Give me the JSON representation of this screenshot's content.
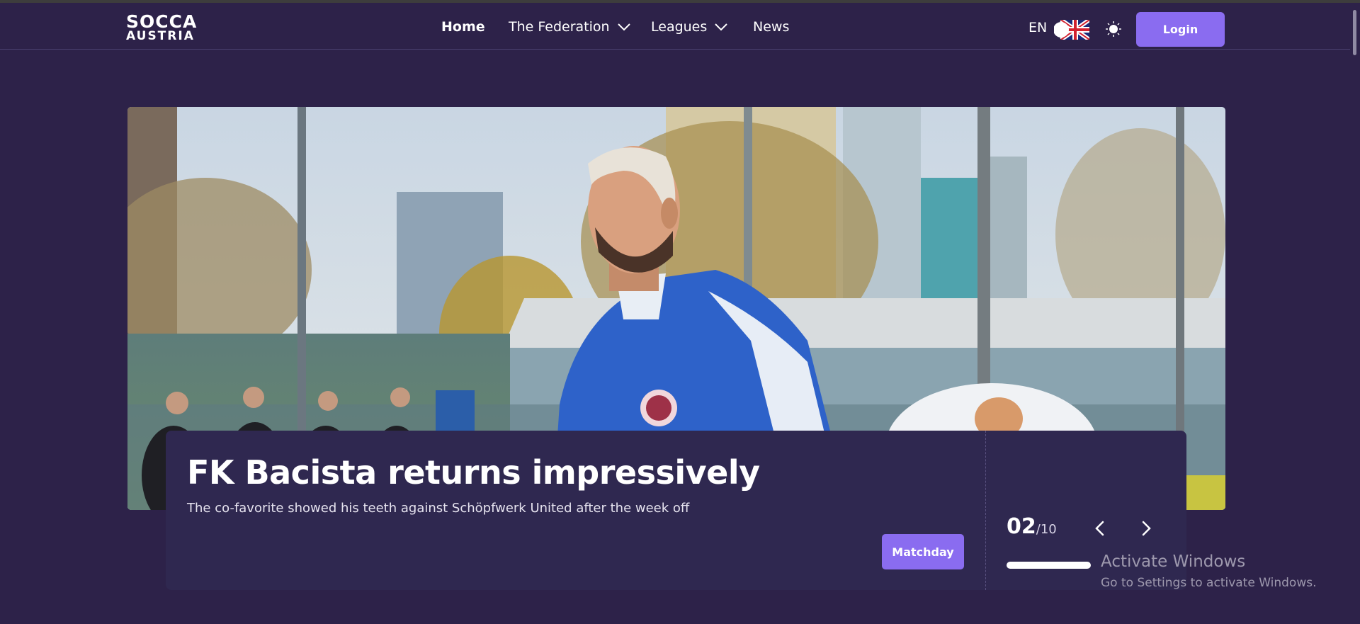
{
  "brand": {
    "line1": "SOCCA",
    "line2": "AUSTRIA"
  },
  "nav": {
    "items": [
      {
        "label": "Home",
        "active": true,
        "dropdown": false
      },
      {
        "label": "The Federation",
        "active": false,
        "dropdown": true
      },
      {
        "label": "Leagues",
        "active": false,
        "dropdown": true
      },
      {
        "label": "News",
        "active": false,
        "dropdown": false
      }
    ]
  },
  "header": {
    "language": "EN",
    "flag_icon": "uk-flag-icon",
    "theme_icon": "sun-icon",
    "login_label": "Login"
  },
  "hero": {
    "headline": "FK Bacista returns impressively",
    "subline": "The co-favorite showed his teeth against Schöpfwerk United after the week off",
    "tag_label": "Matchday",
    "current": "02",
    "total": "/10",
    "prev_icon": "chevron-left-icon",
    "next_icon": "chevron-right-icon",
    "progress_fraction": 0.1
  },
  "watermark": {
    "title": "Activate Windows",
    "subtitle": "Go to Settings to activate Windows."
  },
  "colors": {
    "background": "#2d2249",
    "card": "#2f2850",
    "accent": "#8a6cf0"
  }
}
